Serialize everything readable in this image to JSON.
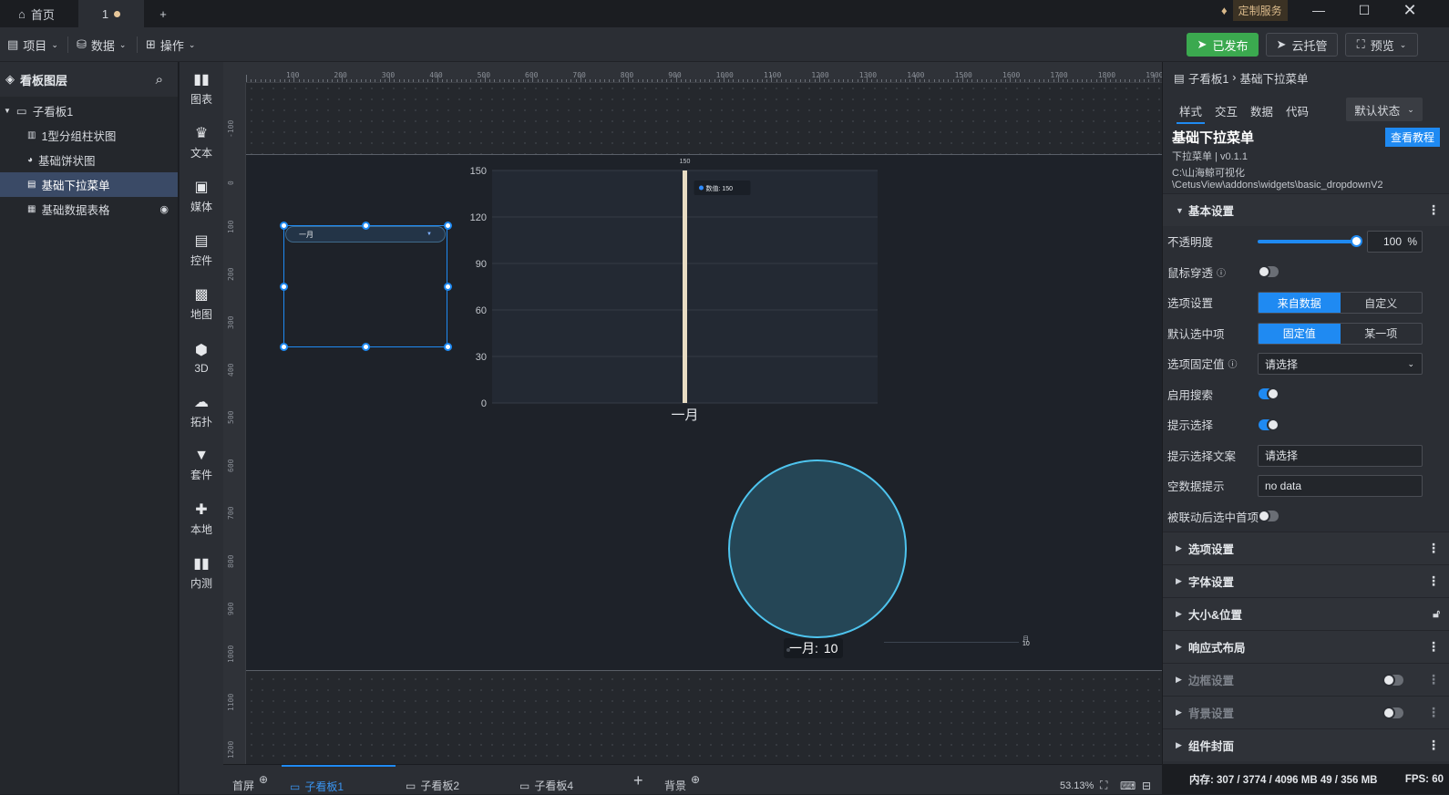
{
  "titlebar": {
    "home": "首页",
    "tab": "1",
    "custom_service": "定制服务"
  },
  "menu": {
    "project": "项目",
    "data": "数据",
    "operation": "操作",
    "publish": "已发布",
    "cloud": "云托管",
    "preview": "预览"
  },
  "layers": {
    "title": "看板图层",
    "items": [
      {
        "label": "子看板1"
      },
      {
        "label": "1型分组柱状图"
      },
      {
        "label": "基础饼状图"
      },
      {
        "label": "基础下拉菜单"
      },
      {
        "label": "基础数据表格"
      }
    ]
  },
  "components": [
    "图表",
    "文本",
    "媒体",
    "控件",
    "地图",
    "3D",
    "拓扑",
    "套件",
    "本地",
    "内测"
  ],
  "ruler": {
    "top": [
      "100",
      "200",
      "300",
      "400",
      "500",
      "600",
      "700",
      "800",
      "900",
      "1000",
      "1100",
      "1200",
      "1300",
      "1400",
      "1500",
      "1600",
      "1700",
      "1800",
      "1900"
    ],
    "left": [
      "-100",
      "0",
      "100",
      "200",
      "300",
      "400",
      "500",
      "600",
      "700",
      "800",
      "900",
      "1000",
      "1100",
      "1200"
    ]
  },
  "canvas": {
    "dropdown_value": "一月",
    "legend_label": "数值",
    "tooltip": "数值: 150",
    "bar_top_label": "150",
    "pie_label": "一月:",
    "pie_value": "10",
    "pie_side_labels": [
      "月",
      "10"
    ]
  },
  "chart_data": [
    {
      "type": "bar",
      "categories": [
        "一月"
      ],
      "series": [
        {
          "name": "数值",
          "values": [
            150
          ]
        }
      ],
      "yticks": [
        "150",
        "120",
        "90",
        "60",
        "30",
        "0"
      ],
      "ylim": [
        0,
        150
      ],
      "colors": [
        "#e8dcc3"
      ]
    },
    {
      "type": "pie",
      "labels": [
        "一月"
      ],
      "values": [
        10
      ],
      "colors": [
        "#254656"
      ]
    }
  ],
  "bottom_tabs": [
    "首屏",
    "子看板1",
    "子看板2",
    "子看板4",
    "背景"
  ],
  "zoom": "53.13%",
  "right": {
    "breadcrumb_parent": "子看板1",
    "breadcrumb_current": "基础下拉菜单",
    "tabs": [
      "样式",
      "交互",
      "数据",
      "代码"
    ],
    "state": "默认状态",
    "comp_title": "基础下拉菜单",
    "tutorial": "查看教程",
    "version": "下拉菜单 | v0.1.1",
    "path1": "C:\\山海鲸可视化",
    "path2": "\\CetusView\\addons\\widgets\\basic_dropdownV2",
    "basic_section": "基本设置",
    "opacity_label": "不透明度",
    "opacity_value": "100",
    "opacity_unit": "%",
    "mouse_through": "鼠标穿透",
    "option_setting": "选项设置",
    "option_from_data": "来自数据",
    "option_custom": "自定义",
    "default_selected": "默认选中项",
    "fixed_value": "固定值",
    "some_item": "某一项",
    "option_fixed": "选项固定值",
    "placeholder_select": "请选择",
    "enable_search": "启用搜索",
    "prompt_select": "提示选择",
    "prompt_text_label": "提示选择文案",
    "prompt_text_value": "请选择",
    "empty_label": "空数据提示",
    "empty_value": "no data",
    "linked_first": "被联动后选中首项",
    "sections": [
      "选项设置",
      "字体设置",
      "大小&位置",
      "响应式布局",
      "边框设置",
      "背景设置",
      "组件封面"
    ]
  },
  "status": {
    "memory": "内存: 307 / 3774 / 4096 MB 49 / 356 MB",
    "fps": "FPS: 60"
  }
}
